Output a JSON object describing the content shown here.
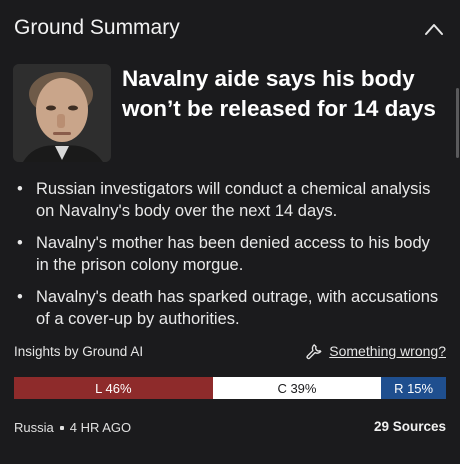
{
  "header": {
    "title": "Ground Summary",
    "collapse_icon": "chevron-up-icon"
  },
  "story": {
    "headline": "Navalny aide says his body won’t be released for 14 days",
    "bullets": [
      "Russian investigators will conduct a chemical analysis on Navalny's body over the next 14 days.",
      "Navalny's mother has been denied access to his body in the prison colony morgue.",
      "Navalny's death has sparked outrage, with accusations of a cover-up by authorities."
    ]
  },
  "insights": {
    "label": "Insights by Ground AI",
    "feedback_label": "Something wrong?",
    "feedback_icon": "wrench-icon"
  },
  "bias": {
    "left": {
      "label": "L 46%",
      "percent": 46,
      "color": "#8e2b2b"
    },
    "center": {
      "label": "C 39%",
      "percent": 39,
      "color": "#ffffff"
    },
    "right": {
      "label": "R 15%",
      "percent": 15,
      "color": "#1f4f8f"
    }
  },
  "footer": {
    "location": "Russia",
    "time": "4 HR AGO",
    "sources": "29 Sources"
  }
}
